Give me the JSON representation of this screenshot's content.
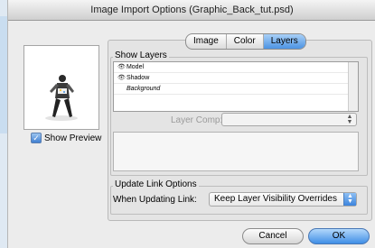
{
  "dialog": {
    "title": "Image Import Options (Graphic_Back_tut.psd)"
  },
  "tabs": [
    {
      "label": "Image",
      "active": false
    },
    {
      "label": "Color",
      "active": false
    },
    {
      "label": "Layers",
      "active": true
    }
  ],
  "preview": {
    "show_preview_label": "Show Preview",
    "show_preview_checked": true
  },
  "show_layers": {
    "title": "Show Layers",
    "layers": [
      {
        "name": "Model",
        "visible": true
      },
      {
        "name": "Shadow",
        "visible": true
      },
      {
        "name": "Background",
        "visible": false
      }
    ]
  },
  "layer_comp": {
    "label": "Layer Comp:",
    "value": ""
  },
  "update_link": {
    "title": "Update Link Options",
    "when_label": "When Updating Link:",
    "selected": "Keep Layer Visibility Overrides"
  },
  "buttons": {
    "cancel": "Cancel",
    "ok": "OK"
  },
  "colors": {
    "accent": "#4c93e3",
    "dialog_bg": "#ececec"
  }
}
